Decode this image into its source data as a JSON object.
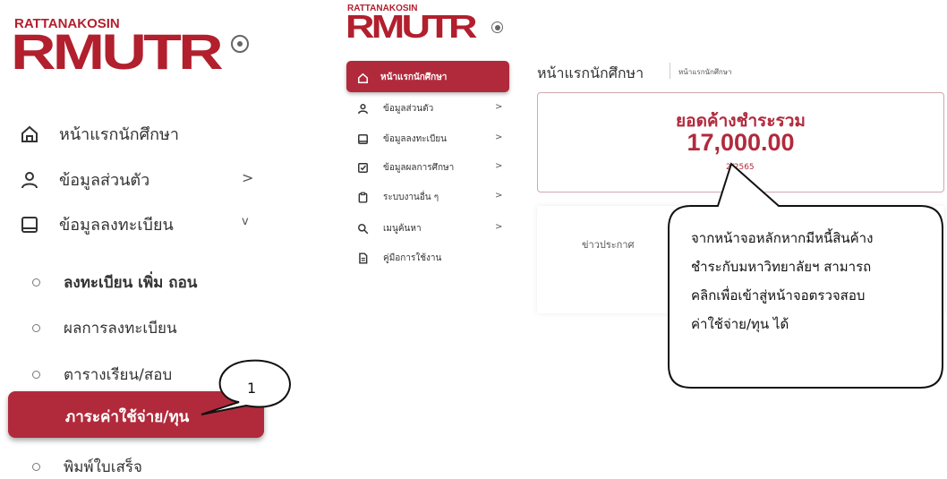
{
  "left_panel": {
    "logo_small": "RATTANAKOSIN",
    "logo_big": "RMUTR",
    "nav": [
      {
        "label": "หน้าแรกนักศึกษา",
        "icon": "home-icon"
      },
      {
        "label": "ข้อมูลส่วนตัว",
        "icon": "user-icon",
        "chevron": ">"
      },
      {
        "label": "ข้อมูลลงทะเบียน",
        "icon": "book-icon",
        "chevron": "v"
      }
    ],
    "sub": [
      {
        "label": "ลงทะเบียน เพิ่ม ถอน"
      },
      {
        "label": "ผลการลงทะเบียน"
      },
      {
        "label": "ตารางเรียน/สอบ"
      },
      {
        "label": "ภาระค่าใช้จ่าย/ทุน",
        "active": true
      },
      {
        "label": "พิมพ์ใบเสร็จ"
      }
    ],
    "callout_number": "1"
  },
  "middle_panel": {
    "logo_small": "RATTANAKOSIN",
    "logo_big": "RMUTR",
    "nav": [
      {
        "label": "หน้าแรกนักศึกษา",
        "icon": "home-icon",
        "active": true
      },
      {
        "label": "ข้อมูลส่วนตัว",
        "icon": "user-icon",
        "chevron": ">"
      },
      {
        "label": "ข้อมูลลงทะเบียน",
        "icon": "book-icon",
        "chevron": ">"
      },
      {
        "label": "ข้อมูลผลการศึกษา",
        "icon": "checkbox-icon",
        "chevron": ">"
      },
      {
        "label": "ระบบงานอื่น ๆ",
        "icon": "clipboard-icon",
        "chevron": ">"
      },
      {
        "label": "เมนูค้นหา",
        "icon": "search-icon",
        "chevron": ">"
      },
      {
        "label": "คู่มือการใช้งาน",
        "icon": "document-icon"
      }
    ]
  },
  "content": {
    "page_title": "หน้าแรกนักศึกษา",
    "breadcrumb": "หน้าแรกนักศึกษา",
    "outstanding": {
      "title": "ยอดค้างชำระรวม",
      "amount": "17,000.00",
      "year": "2/2565"
    },
    "news_label": "ข่าวประกาศ"
  },
  "callout": {
    "lines": [
      "จากหน้าจอหลักหากมีหนี้สินค้าง",
      "ชำระกับมหาวิทยาลัยฯ สามารถ",
      "คลิกเพื่อเข้าสู่หน้าจอตรวจสอบ",
      "ค่าใช้จ่าย/ทุน ได้"
    ]
  },
  "colors": {
    "brand": "#b12a3c",
    "logo": "#b21f2d"
  }
}
